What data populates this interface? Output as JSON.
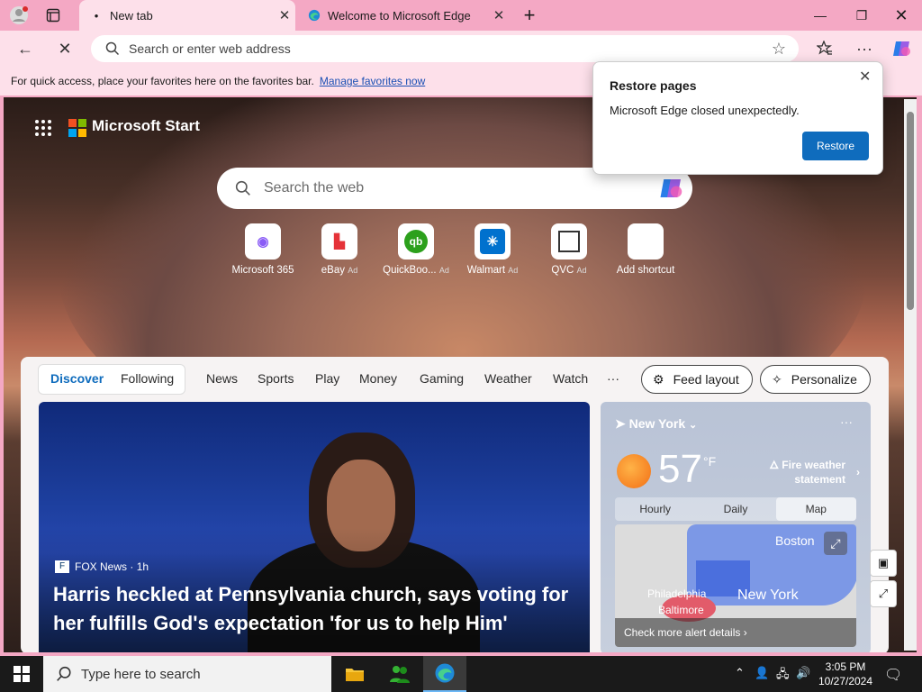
{
  "browser": {
    "tabs": [
      {
        "label": "New tab",
        "active": true
      },
      {
        "label": "Welcome to Microsoft Edge",
        "active": false
      }
    ],
    "new_tab_symbol": "+",
    "address_placeholder": "Search or enter web address",
    "favorites_bar": {
      "text": "For quick access, place your favorites here on the favorites bar.",
      "link": "Manage favorites now"
    }
  },
  "restore_popup": {
    "title": "Restore pages",
    "message": "Microsoft Edge closed unexpectedly.",
    "button": "Restore"
  },
  "start_page": {
    "brand": "Microsoft Start",
    "search_placeholder": "Search the web",
    "shortcuts": [
      {
        "label": "Microsoft 365",
        "ad": "",
        "icon": "m365-icon"
      },
      {
        "label": "eBay",
        "ad": "Ad",
        "icon": "ebay-icon"
      },
      {
        "label": "QuickBoo...",
        "ad": "Ad",
        "icon": "quickbooks-icon"
      },
      {
        "label": "Walmart",
        "ad": "Ad",
        "icon": "walmart-icon"
      },
      {
        "label": "QVC",
        "ad": "Ad",
        "icon": "qvc-icon"
      },
      {
        "label": "Add shortcut",
        "ad": "",
        "icon": "plus-icon"
      }
    ],
    "feed_tabs": {
      "discover": "Discover",
      "following": "Following",
      "items": [
        "News",
        "Sports",
        "Play",
        "Money",
        "Gaming",
        "Weather",
        "Watch"
      ],
      "more": "···"
    },
    "feed_layout": "Feed layout",
    "personalize": "Personalize",
    "hero": {
      "source": "FOX News",
      "age": "· 1h",
      "headline": "Harris heckled at Pennsylvania church, says voting for her fulfills God's expectation 'for us to help Him'"
    },
    "weather": {
      "location": "New York",
      "temp": "57",
      "unit": "°F",
      "alert": "Fire weather statement",
      "tabs": [
        "Hourly",
        "Daily",
        "Map"
      ],
      "active_tab": "Map",
      "cities": {
        "boston": "Boston",
        "philadelphia": "Philadelphia",
        "baltimore": "Baltimore",
        "newyork": "New York"
      },
      "footer": "Check more alert details"
    }
  },
  "taskbar": {
    "search_placeholder": "Type here to search",
    "time": "3:05 PM",
    "date": "10/27/2024"
  },
  "colors": {
    "frame": "#f4a8c4",
    "tab_active": "#fde0ea",
    "accent": "#0f6cbd"
  }
}
